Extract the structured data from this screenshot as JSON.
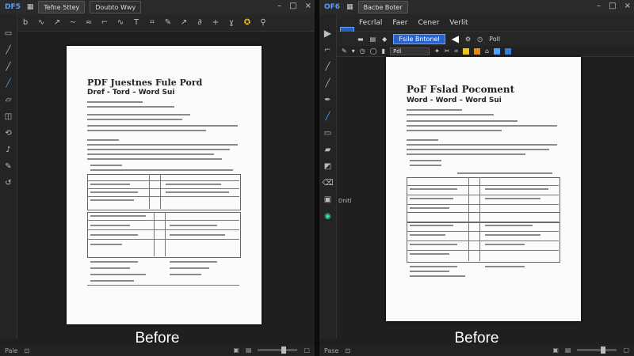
{
  "left": {
    "titlebar": {
      "app": "DF5",
      "tabs": [
        "Tefne 5ttey",
        "Doubto Wwy"
      ]
    },
    "window_controls": [
      "–",
      "□",
      "×"
    ],
    "doc": {
      "title": "PDF Juestnes Fule Pord",
      "subtitle": "Dref - Tord – Word Sui"
    },
    "caption": "Before",
    "status": "Pale"
  },
  "right": {
    "titlebar": {
      "app": "OF6",
      "tabs": [
        "Bacbe Boter"
      ]
    },
    "window_controls": [
      "–",
      "□",
      "×"
    ],
    "menu": [
      "Fecrlal",
      "Faer",
      "Cener",
      "Verlit"
    ],
    "path": "Fsile Bntonel",
    "toolbar_label": "Poll",
    "input_value": "Pdl",
    "panel_label": "Dnitl",
    "doc": {
      "title": "PoF Fslad Pocoment",
      "subtitle": "Word - Word – Word Sui"
    },
    "caption": "Before",
    "status": "Pase"
  },
  "colors": {
    "accent": "#4da3ff",
    "highlight": "#2962c9",
    "yellow": "#f0c419",
    "green": "#3ddc97"
  }
}
